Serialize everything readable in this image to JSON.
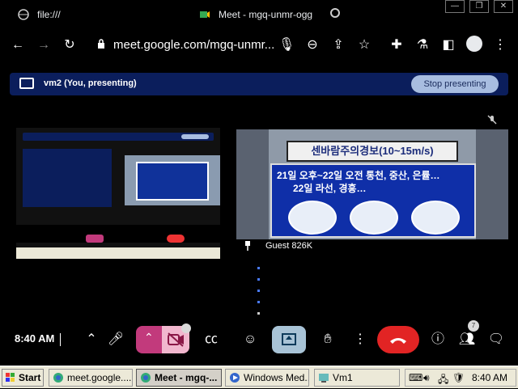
{
  "browser": {
    "tabs": [
      {
        "label": "file:///"
      },
      {
        "label": "Meet - mgq-unmr-ogg"
      }
    ],
    "url": "meet.google.com/mgq-unmr..."
  },
  "presenting_bar": {
    "label": "vm2 (You, presenting)",
    "stop_label": "Stop presenting"
  },
  "tiles": {
    "guest_name": "Guest 826K",
    "sign": {
      "title": "센바람주의경보(10~15m/s)",
      "line1": "21일 오후~22일 오전  통천, 중산, 은률…",
      "line2": "22일            라선, 경흥…"
    }
  },
  "meet_bar": {
    "time": "8:40 AM",
    "camera_badge": "",
    "people_count": "7"
  },
  "taskbar": {
    "start": "Start",
    "items": [
      {
        "label": "meet.google...."
      },
      {
        "label": "Meet - mgq-..."
      },
      {
        "label": "Windows Med..."
      },
      {
        "label": "Vm1"
      }
    ],
    "clock": "8:40 AM"
  },
  "colors": {
    "presenting_bar": "#0b1e5c",
    "hangup": "#e22424",
    "camera_off": "#c23a7c"
  }
}
